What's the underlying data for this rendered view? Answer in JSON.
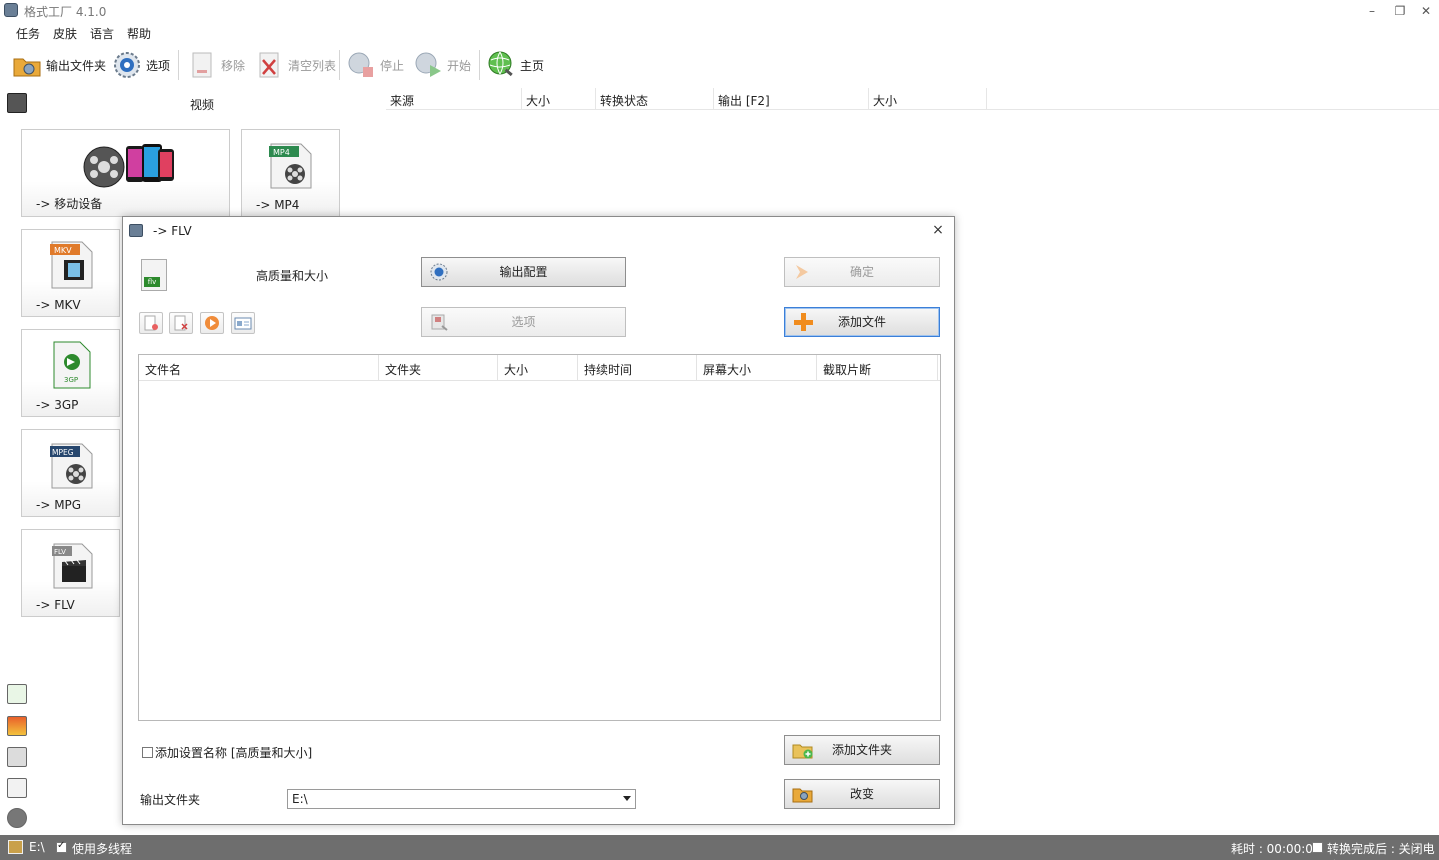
{
  "window": {
    "title": "格式工厂 4.1.0",
    "minimize": "–",
    "restore": "❐",
    "close": "✕"
  },
  "menu": [
    "任务",
    "皮肤",
    "语言",
    "帮助"
  ],
  "toolbar": {
    "output_folder": "输出文件夹",
    "options": "选项",
    "remove": "移除",
    "clear_list": "清空列表",
    "stop": "停止",
    "start": "开始",
    "home": "主页"
  },
  "left_panel": {
    "category": "视频",
    "tiles": [
      "-> 移动设备",
      "-> MP4",
      "-> MKV",
      "-> 3GP",
      "-> MPG",
      "-> FLV"
    ],
    "tile_tags": {
      "mp4": "MP4",
      "mkv": "MKV",
      "gp3": "3GP",
      "mpeg": "MPEG",
      "flv": "FLV"
    }
  },
  "main_list": {
    "columns": [
      "来源",
      "大小",
      "转换状态",
      "输出 [F2]",
      "大小"
    ]
  },
  "dialog": {
    "title": "-> FLV",
    "close": "×",
    "badge": "flv",
    "quality": "高质量和大小",
    "output_config": "输出配置",
    "options": "选项",
    "ok": "确定",
    "add_file": "添加文件",
    "add_folder": "添加文件夹",
    "change": "改变",
    "columns": [
      "文件名",
      "文件夹",
      "大小",
      "持续时间",
      "屏幕大小",
      "截取片断"
    ],
    "add_setting_name": "添加设置名称 [高质量和大小]",
    "output_folder_label": "输出文件夹",
    "output_folder_value": "E:\\"
  },
  "statusbar": {
    "path": "E:\\",
    "multithread": "使用多线程",
    "elapsed": "耗时 : 00:00:00",
    "after_done": "转换完成后 : 关闭电脑"
  },
  "colors": {
    "accent_blue": "#3b7fd8",
    "status_bar": "#6e6e6e",
    "flv_green": "#2d8a2d",
    "add_orange": "#f08c1e"
  }
}
